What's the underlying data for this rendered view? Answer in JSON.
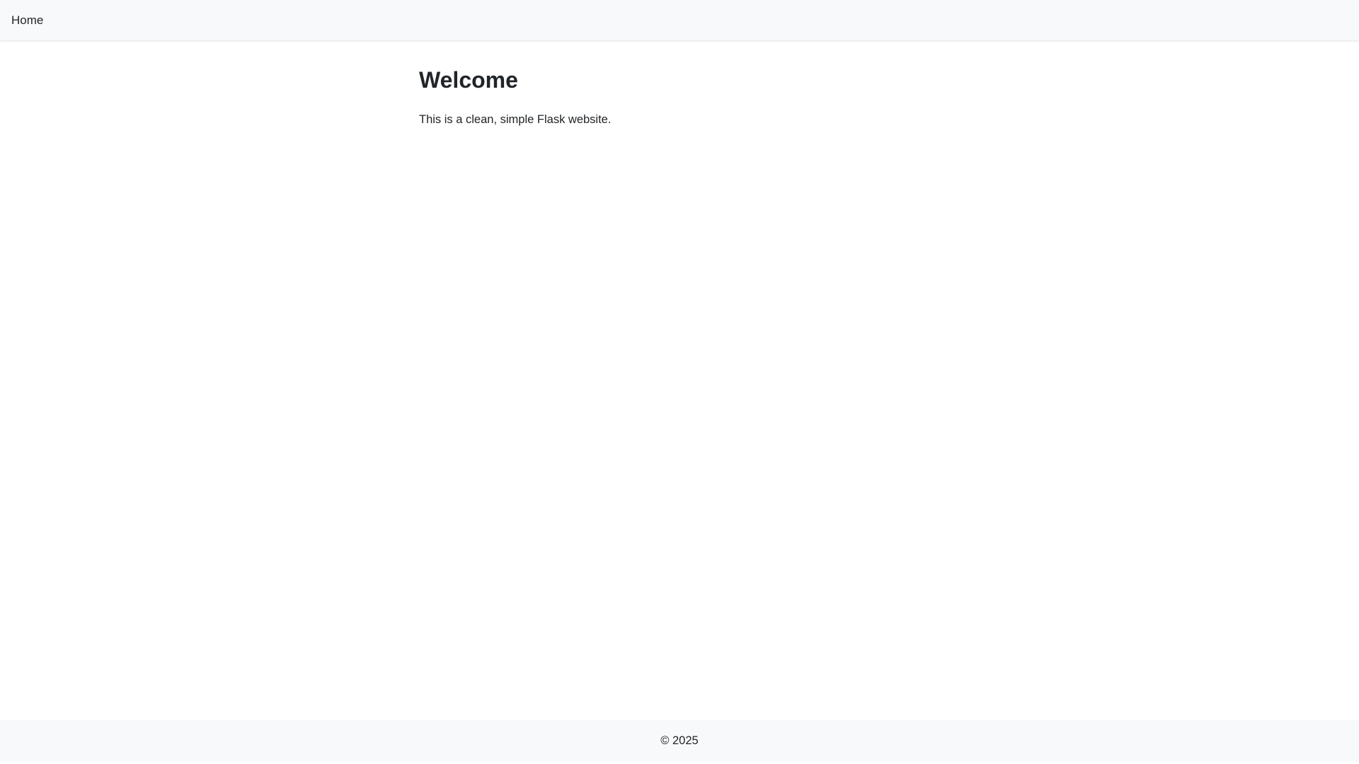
{
  "nav": {
    "home_label": "Home"
  },
  "main": {
    "title": "Welcome",
    "intro": "This is a clean, simple Flask website."
  },
  "footer": {
    "text": "© 2025"
  },
  "colors": {
    "navbar_bg": "#f8f9fa",
    "footer_bg": "#f8f9fa",
    "text": "#212529",
    "page_bg": "#ffffff"
  }
}
